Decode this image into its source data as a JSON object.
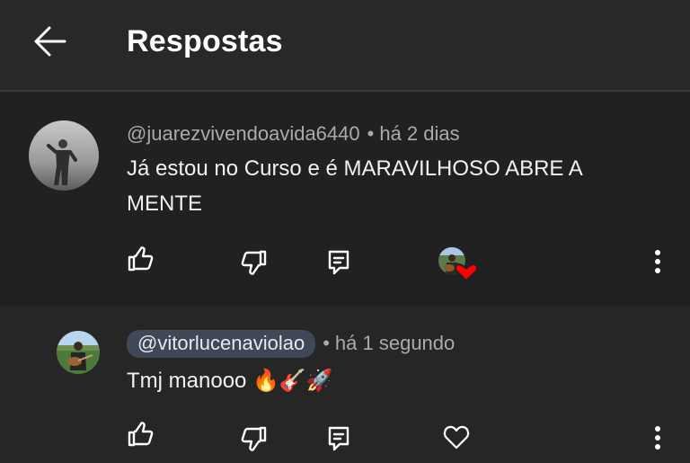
{
  "header": {
    "title": "Respostas",
    "back_icon": "arrow-left-icon"
  },
  "comment": {
    "author": "@juarezvivendoavida6440",
    "separator": "•",
    "time": "há 2 dias",
    "text_line1": "Já estou  no Curso  e é MARAVILHOSO ABRE A",
    "text_line2": "MENTE",
    "actions": [
      "like-icon",
      "dislike-icon",
      "reply-icon",
      "creator-heart-icon",
      "more-vert-icon"
    ]
  },
  "reply": {
    "author": "@vitorlucenaviolao",
    "separator": "•",
    "time": "há 1 segundo",
    "text": "Tmj manooo 🔥🎸🚀",
    "actions": [
      "like-icon",
      "dislike-icon",
      "reply-icon",
      "heart-icon",
      "more-vert-icon"
    ]
  },
  "colors": {
    "background": "#212121",
    "header_bg": "#282828",
    "reply_bg": "#262626",
    "author_chip_bg": "#3e4857",
    "heart_red": "#ff0000"
  }
}
